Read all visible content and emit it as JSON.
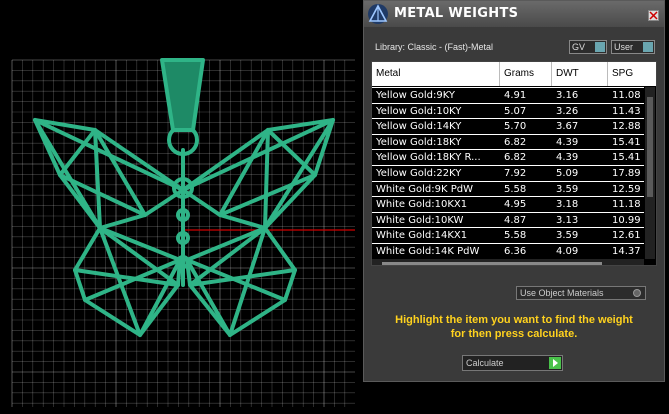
{
  "panel": {
    "title": "METAL WEIGHTS",
    "library_label": "Library: Classic - (Fast)-Metal",
    "gv_label": "GV",
    "user_label": "User",
    "table": {
      "headers": [
        "Metal",
        "Grams",
        "DWT",
        "SPG"
      ],
      "rows": [
        [
          "Yellow Gold:9KY",
          "4.91",
          "3.16",
          "11.08"
        ],
        [
          "Yellow Gold:10KY",
          "5.07",
          "3.26",
          "11.43"
        ],
        [
          "Yellow Gold:14KY",
          "5.70",
          "3.67",
          "12.88"
        ],
        [
          "Yellow Gold:18KY",
          "6.82",
          "4.39",
          "15.41"
        ],
        [
          "Yellow Gold:18KY R...",
          "6.82",
          "4.39",
          "15.41"
        ],
        [
          "Yellow Gold:22KY",
          "7.92",
          "5.09",
          "17.89"
        ],
        [
          "White Gold:9K PdW",
          "5.58",
          "3.59",
          "12.59"
        ],
        [
          "White Gold:10KX1",
          "4.95",
          "3.18",
          "11.18"
        ],
        [
          "White Gold:10KW",
          "4.87",
          "3.13",
          "10.99"
        ],
        [
          "White Gold:14KX1",
          "5.58",
          "3.59",
          "12.61"
        ],
        [
          "White Gold:14K PdW",
          "6.36",
          "4.09",
          "14.37"
        ]
      ]
    },
    "use_object_materials": "Use Object Materials",
    "instructions_line1": "Highlight the item you want to find the weight",
    "instructions_line2": "for then press calculate.",
    "calculate_label": "Calculate"
  },
  "colors": {
    "model": "#2fb487",
    "grid": "#ffffff",
    "axis": "#d00000",
    "instructions": "#ffd21e",
    "calc_arrow": "#49c24a"
  },
  "icons": {
    "app": "rhino-triangle-icon",
    "close": "close-icon",
    "calculate": "play-arrow-icon"
  }
}
